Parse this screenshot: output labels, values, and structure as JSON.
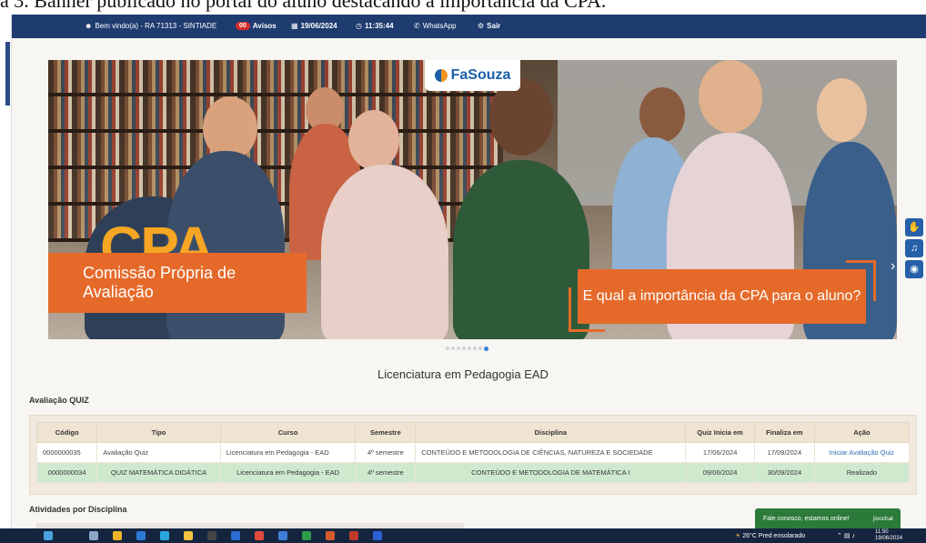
{
  "caption": "a 3. Banner publicado no portal do aluno destacando a importância da CPA.",
  "topbar": {
    "welcome": "Bem vindo(a) - RA 71313 - SINTIADE",
    "notices_count": "00",
    "notices_label": "Avisos",
    "date": "19/06/2024",
    "time": "11:35:44",
    "whatsapp": "WhatsApp",
    "logout": "Sair"
  },
  "banner": {
    "logo_text": "FaSouza",
    "headline": "CPA",
    "subtitle": "Comissão Própria de Avaliação",
    "question": "E qual a importância da CPA para o aluno?",
    "slide_count": 8,
    "active_slide": 8
  },
  "course_title": "Licenciatura em Pedagogia EAD",
  "quiz_section": {
    "title": "Avaliação QUIZ",
    "columns": [
      "Código",
      "Tipo",
      "Curso",
      "Semestre",
      "Disciplina",
      "Quiz Inicia em",
      "Finaliza em",
      "Ação"
    ],
    "rows": [
      {
        "codigo": "0000000035",
        "tipo": "Avaliação Quiz",
        "curso": "Licenciatura em Pedagogia - EAD",
        "semestre": "4º semestre",
        "disciplina": "CONTEÚDO E METODOLOGIA DE CIÊNCIAS, NATUREZA E SOCIEDADE",
        "inicio": "17/06/2024",
        "fim": "17/09/2024",
        "acao": "Iniciar Avaliação Quiz"
      },
      {
        "codigo": "0000000034",
        "tipo": "QUIZ MATEMÁTICA DIDÁTICA",
        "curso": "Licenciatura em Pedagogia - EAD",
        "semestre": "4º semestre",
        "disciplina": "CONTEÚDO E METODOLOGIA DE MATEMÁTICA I",
        "inicio": "09/06/2024",
        "fim": "30/09/2024",
        "acao": "Realizado"
      }
    ]
  },
  "activities_title": "Atividades por Disciplina",
  "chat": {
    "message": "Fale conosco, estamos online!",
    "brand": "jivochat"
  },
  "taskbar": {
    "weather": "26°C  Pred ensolarado",
    "clock_time": "11:50",
    "clock_date": "19/06/2024"
  },
  "colors": {
    "topbar": "#1f3c70",
    "accent_orange": "#e56a2a",
    "done_row": "#cfe9cf",
    "link": "#2f6db5"
  }
}
